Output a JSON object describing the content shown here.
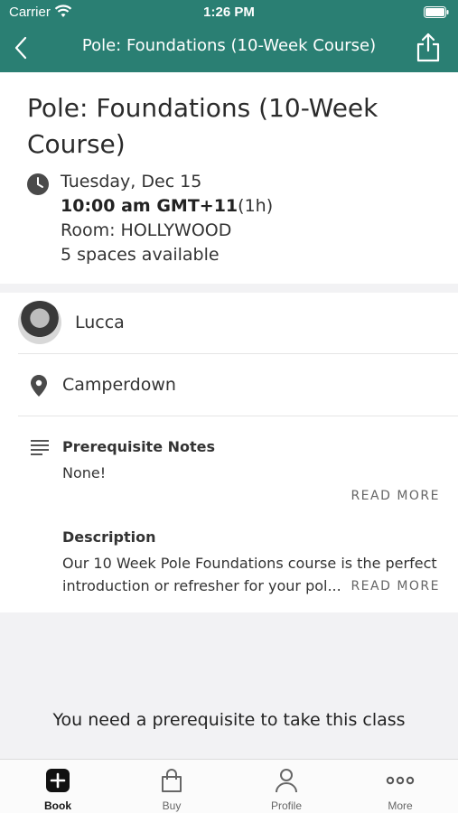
{
  "status_bar": {
    "carrier": "Carrier",
    "time": "1:26 PM"
  },
  "nav": {
    "title": "Pole: Foundations (10-Week Course)"
  },
  "class": {
    "title": "Pole: Foundations (10-Week Course)",
    "date": "Tuesday, Dec 15",
    "time": "10:00 am GMT+11",
    "duration": "(1h)",
    "room": "Room: HOLLYWOOD",
    "spaces": "5 spaces available"
  },
  "instructor": {
    "name": "Lucca"
  },
  "location": {
    "name": "Camperdown"
  },
  "prerequisite": {
    "heading": "Prerequisite Notes",
    "text": "None!",
    "read_more": "READ MORE"
  },
  "description": {
    "heading": "Description",
    "line1": "Our 10 Week Pole Foundations course is the perfect",
    "line2": "introduction or refresher for your pol...",
    "read_more": "READ MORE"
  },
  "message": "You need a prerequisite to take this class",
  "tabs": [
    {
      "label": "Book",
      "icon": "plus-square-icon",
      "active": true
    },
    {
      "label": "Buy",
      "icon": "shopping-bag-icon",
      "active": false
    },
    {
      "label": "Profile",
      "icon": "person-icon",
      "active": false
    },
    {
      "label": "More",
      "icon": "ellipsis-icon",
      "active": false
    }
  ],
  "colors": {
    "header": "#2a7f73",
    "background": "#f2f2f4"
  }
}
